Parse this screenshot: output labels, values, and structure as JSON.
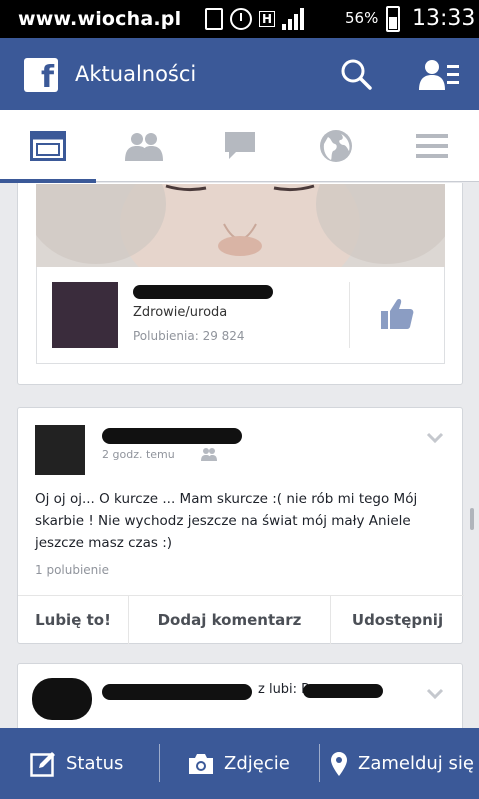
{
  "status_bar": {
    "watermark": "www.wiocha.pl",
    "network": "H",
    "network_sub": "R",
    "battery_percent": "56%",
    "time": "13:33"
  },
  "header": {
    "logo": "f",
    "title": "Aktualności",
    "icons": [
      "search-icon",
      "friend-requests-icon"
    ],
    "bg_color": "#3b5998"
  },
  "tabs": [
    {
      "icon": "news-feed-icon",
      "active": true
    },
    {
      "icon": "friends-icon",
      "active": false
    },
    {
      "icon": "messages-icon",
      "active": false
    },
    {
      "icon": "globe-icon",
      "active": false
    },
    {
      "icon": "menu-icon",
      "active": false
    }
  ],
  "feed": {
    "shared_page": {
      "category": "Zdrowie/uroda",
      "likes": "Polubienia: 29 824"
    },
    "post": {
      "time": "2 godz. temu",
      "text": "Oj oj oj... O kurcze ... Mam skurcze :( nie rób mi tego Mój skarbie ! Nie wychodz jeszcze na świat mój mały Aniele jeszcze masz czas :)",
      "likes": "1 polubienie",
      "actions": {
        "like": "Lubię to!",
        "comment": "Dodaj komentarz",
        "share": "Udostępnij"
      }
    },
    "next_post": {
      "likes_text": "z lubi: P"
    }
  },
  "bottom_bar": {
    "status": "Status",
    "photo": "Zdjęcie",
    "checkin": "Zamelduj się"
  }
}
